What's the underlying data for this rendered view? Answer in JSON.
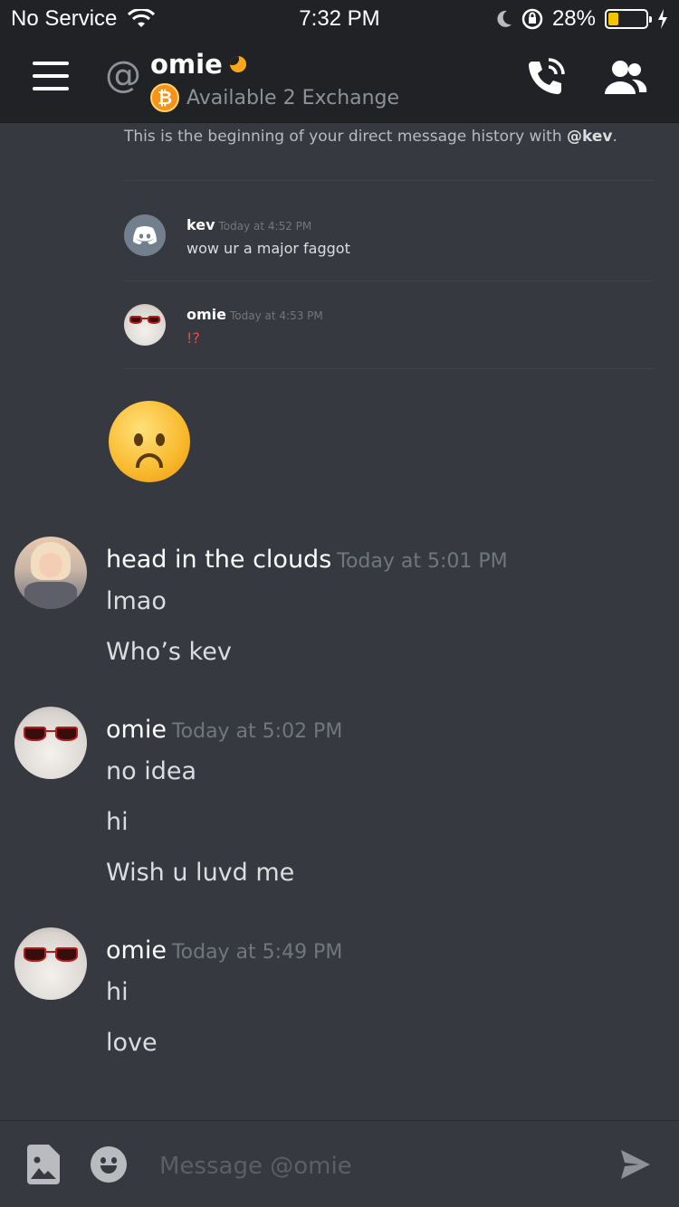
{
  "status_bar": {
    "carrier": "No Service",
    "time": "7:32 PM",
    "battery_percent": "28%",
    "battery_level": 0.28,
    "battery_color": "#f5c400"
  },
  "header": {
    "username": "omie",
    "status_text": "Available 2 Exchange",
    "presence": "idle",
    "presence_color": "#faa61a",
    "status_emoji": "bitcoin-icon"
  },
  "chat": {
    "beginning_prefix": "This is the beginning of your direct message history with ",
    "beginning_user": "@kev",
    "beginning_suffix": ".",
    "embedded_messages": [
      {
        "author": "kev",
        "timestamp": "Today at 4:52 PM",
        "text": "wow ur a major faggot",
        "avatar": "discord-logo-icon"
      },
      {
        "author": "omie",
        "timestamp": "Today at 4:53 PM",
        "text": "!?",
        "avatar": "ghost-sunglasses-avatar"
      }
    ],
    "emoji": "frowning-face-with-open-mouth",
    "groups": [
      {
        "author": "head in the clouds",
        "timestamp": "Today at 5:01 PM",
        "lines": [
          "lmao",
          "Who’s kev"
        ]
      },
      {
        "author": "omie",
        "timestamp": "Today at 5:02 PM",
        "lines": [
          "no idea",
          "hi",
          "Wish u luvd me"
        ]
      },
      {
        "author": "omie",
        "timestamp": "Today at 5:49 PM",
        "lines": [
          "hi",
          "love"
        ]
      }
    ]
  },
  "input": {
    "placeholder": "Message @omie",
    "value": ""
  }
}
